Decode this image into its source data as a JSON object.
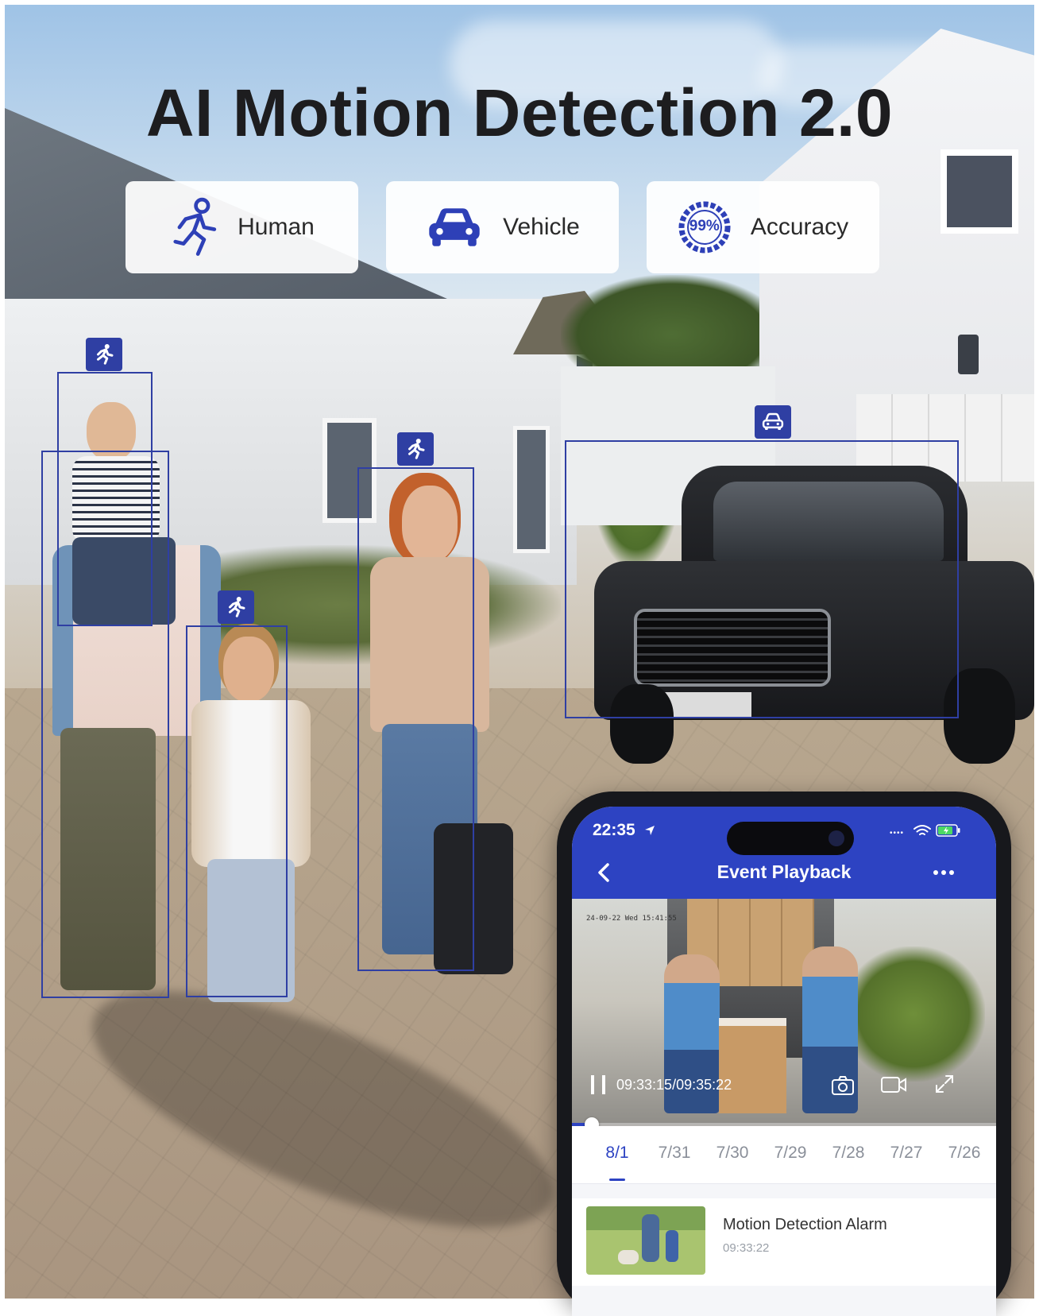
{
  "headline": "AI Motion Detection 2.0",
  "features": [
    {
      "label": "Human",
      "icon": "running-person-icon"
    },
    {
      "label": "Vehicle",
      "icon": "car-icon"
    },
    {
      "label": "Accuracy",
      "icon": "accuracy-gauge-icon",
      "badge": "99%"
    }
  ],
  "detections": [
    {
      "type": "human",
      "icon": "running-person-icon"
    },
    {
      "type": "human",
      "icon": "running-person-icon"
    },
    {
      "type": "human",
      "icon": "running-person-icon"
    },
    {
      "type": "human",
      "icon": "running-person-icon"
    },
    {
      "type": "vehicle",
      "icon": "car-icon"
    }
  ],
  "phone": {
    "status": {
      "time": "22:35"
    },
    "appbar": {
      "title": "Event Playback",
      "back_icon": "chevron-left-icon",
      "more_icon": "more-icon"
    },
    "video": {
      "osd_timestamp": "24-09-22 Wed 15:41:55",
      "playback_time": "09:33:15/09:35:22",
      "controls": [
        "pause-icon",
        "camera-icon",
        "record-icon",
        "fullscreen-icon"
      ],
      "progress": 0.03
    },
    "date_tabs": [
      "8/1",
      "7/31",
      "7/30",
      "7/29",
      "7/28",
      "7/27",
      "7/26"
    ],
    "active_tab": "8/1",
    "events": [
      {
        "title": "Motion Detection Alarm",
        "time": "09:33:22"
      }
    ]
  },
  "colors": {
    "accent": "#2f3fa3",
    "app_blue": "#2d43c2"
  }
}
